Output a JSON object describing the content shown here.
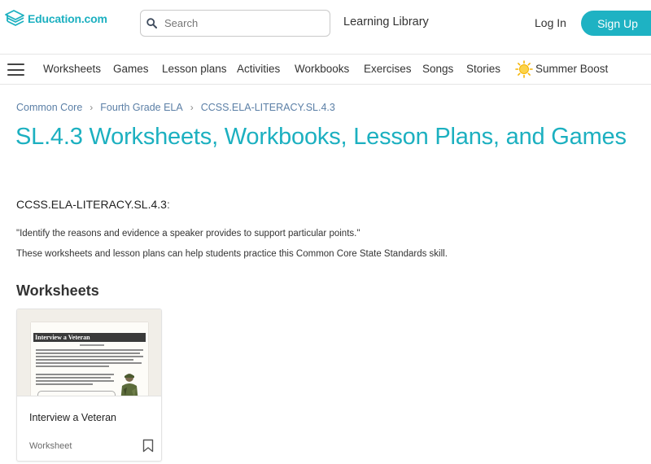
{
  "header": {
    "logo_text": "Education.com",
    "search_placeholder": "Search",
    "learning_library": "Learning Library",
    "login": "Log In",
    "signup": "Sign Up"
  },
  "nav": {
    "items": [
      "Worksheets",
      "Games",
      "Lesson plans",
      "Activities",
      "Workbooks",
      "Exercises",
      "Songs",
      "Stories"
    ],
    "summer_boost": "Summer Boost"
  },
  "breadcrumb": [
    "Common Core",
    "Fourth Grade ELA",
    "CCSS.ELA-LITERACY.SL.4.3"
  ],
  "page": {
    "title": "SL.4.3 Worksheets, Workbooks, Lesson Plans, and Games",
    "standard_code": "CCSS.ELA-LITERACY.SL.4.3",
    "standard_colon": ":",
    "quote": "\"Identify the reasons and evidence a speaker provides to support particular points.\"",
    "description": "These worksheets and lesson plans can help students practice this Common Core State Standards skill.",
    "section_title": "Worksheets"
  },
  "cards": [
    {
      "title": "Interview a Veteran",
      "type": "Worksheet",
      "thumbnail_heading": "Interview a Veteran"
    }
  ],
  "colors": {
    "brand": "#1cb0c0",
    "signup_bg": "#1eb2c3",
    "breadcrumb": "#5b7fa6",
    "sun": "#f5b400"
  },
  "icons": {
    "logo": "education-logo-icon",
    "search": "search-icon",
    "menu": "hamburger-menu-icon",
    "summer": "sun-icon",
    "bookmark": "bookmark-icon",
    "breadcrumb_separator": "chevron-right-icon"
  }
}
